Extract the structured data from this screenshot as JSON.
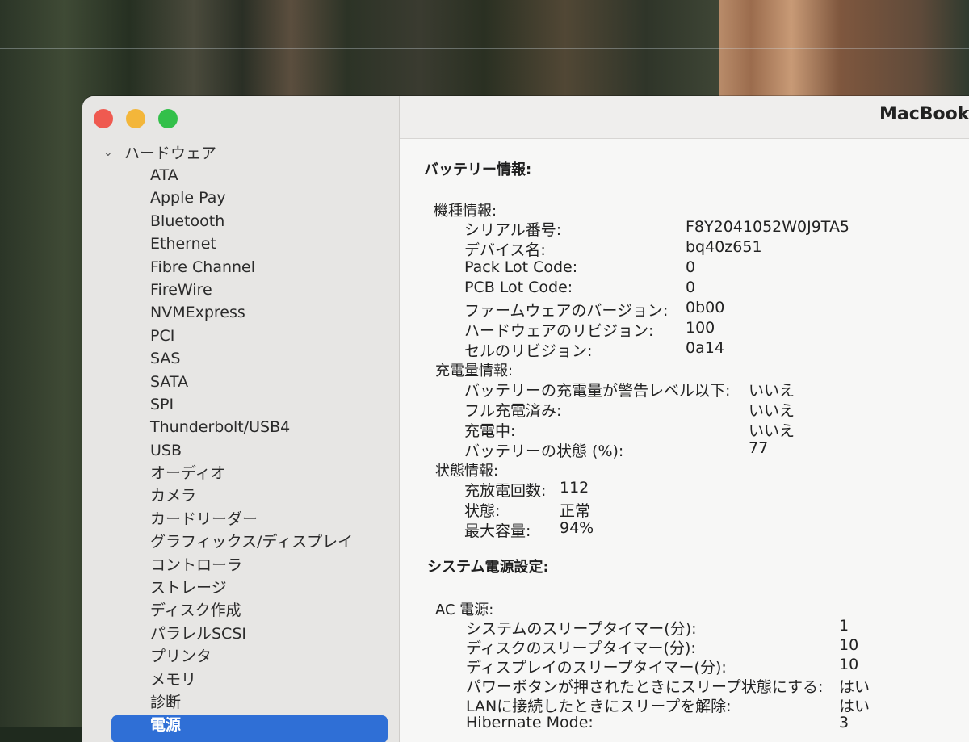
{
  "window": {
    "title": "MacBook"
  },
  "sidebar": {
    "section": "ハードウェア",
    "items": [
      "ATA",
      "Apple Pay",
      "Bluetooth",
      "Ethernet",
      "Fibre Channel",
      "FireWire",
      "NVMExpress",
      "PCI",
      "SAS",
      "SATA",
      "SPI",
      "Thunderbolt/USB4",
      "USB",
      "オーディオ",
      "カメラ",
      "カードリーダー",
      "グラフィックス/ディスプレイ",
      "コントローラ",
      "ストレージ",
      "ディスク作成",
      "パラレルSCSI",
      "プリンタ",
      "メモリ",
      "診断",
      "電源"
    ],
    "selected": "電源"
  },
  "battery": {
    "heading": "バッテリー情報:",
    "model": {
      "label": "機種情報:",
      "serial_label": "シリアル番号:",
      "serial": "F8Y2041052W0J9TA5",
      "device_label": "デバイス名:",
      "device": "bq40z651",
      "packlot_label": "Pack Lot Code:",
      "packlot": "0",
      "pcblot_label": "PCB Lot Code:",
      "pcblot": "0",
      "firmware_label": "ファームウェアのバージョン:",
      "firmware": "0b00",
      "hw_rev_label": "ハードウェアのリビジョン:",
      "hw_rev": "100",
      "cell_rev_label": "セルのリビジョン:",
      "cell_rev": "0a14"
    },
    "charge": {
      "label": "充電量情報:",
      "below_warn_label": "バッテリーの充電量が警告レベル以下:",
      "below_warn": "いいえ",
      "full_label": "フル充電済み:",
      "full": "いいえ",
      "charging_label": "充電中:",
      "charging": "いいえ",
      "state_label": "バッテリーの状態 (%):",
      "state": "77"
    },
    "health": {
      "label": "状態情報:",
      "cycles_label": "充放電回数:",
      "cycles": "112",
      "condition_label": "状態:",
      "condition": "正常",
      "capacity_label": "最大容量:",
      "capacity": "94%"
    }
  },
  "power": {
    "heading": "システム電源設定:",
    "ac": {
      "label": "AC 電源:",
      "sys_sleep_label": "システムのスリープタイマー(分):",
      "sys_sleep": "1",
      "disk_sleep_label": "ディスクのスリープタイマー(分):",
      "disk_sleep": "10",
      "display_sleep_label": "ディスプレイのスリープタイマー(分):",
      "display_sleep": "10",
      "power_button_label": "パワーボタンが押されたときにスリープ状態にする:",
      "power_button": "はい",
      "lan_wake_label": "LANに接続したときにスリープを解除:",
      "lan_wake": "はい",
      "hibernate_label": "Hibernate Mode:",
      "hibernate": "3"
    }
  }
}
